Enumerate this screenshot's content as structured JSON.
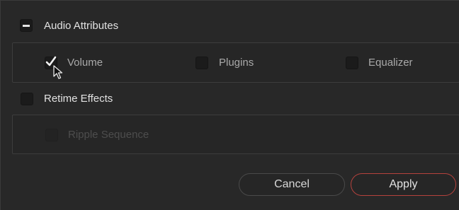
{
  "audio_attributes": {
    "label": "Audio Attributes",
    "toggle_state": "minus",
    "options": [
      {
        "label": "Volume",
        "checked": true
      },
      {
        "label": "Plugins",
        "checked": false
      },
      {
        "label": "Equalizer",
        "checked": false
      }
    ]
  },
  "retime_effects": {
    "label": "Retime Effects",
    "checked": false,
    "options": [
      {
        "label": "Ripple Sequence",
        "checked": false,
        "disabled": true
      }
    ]
  },
  "buttons": {
    "cancel_label": "Cancel",
    "apply_label": "Apply"
  },
  "colors": {
    "accent": "#b5423d",
    "panel": "#282828"
  }
}
